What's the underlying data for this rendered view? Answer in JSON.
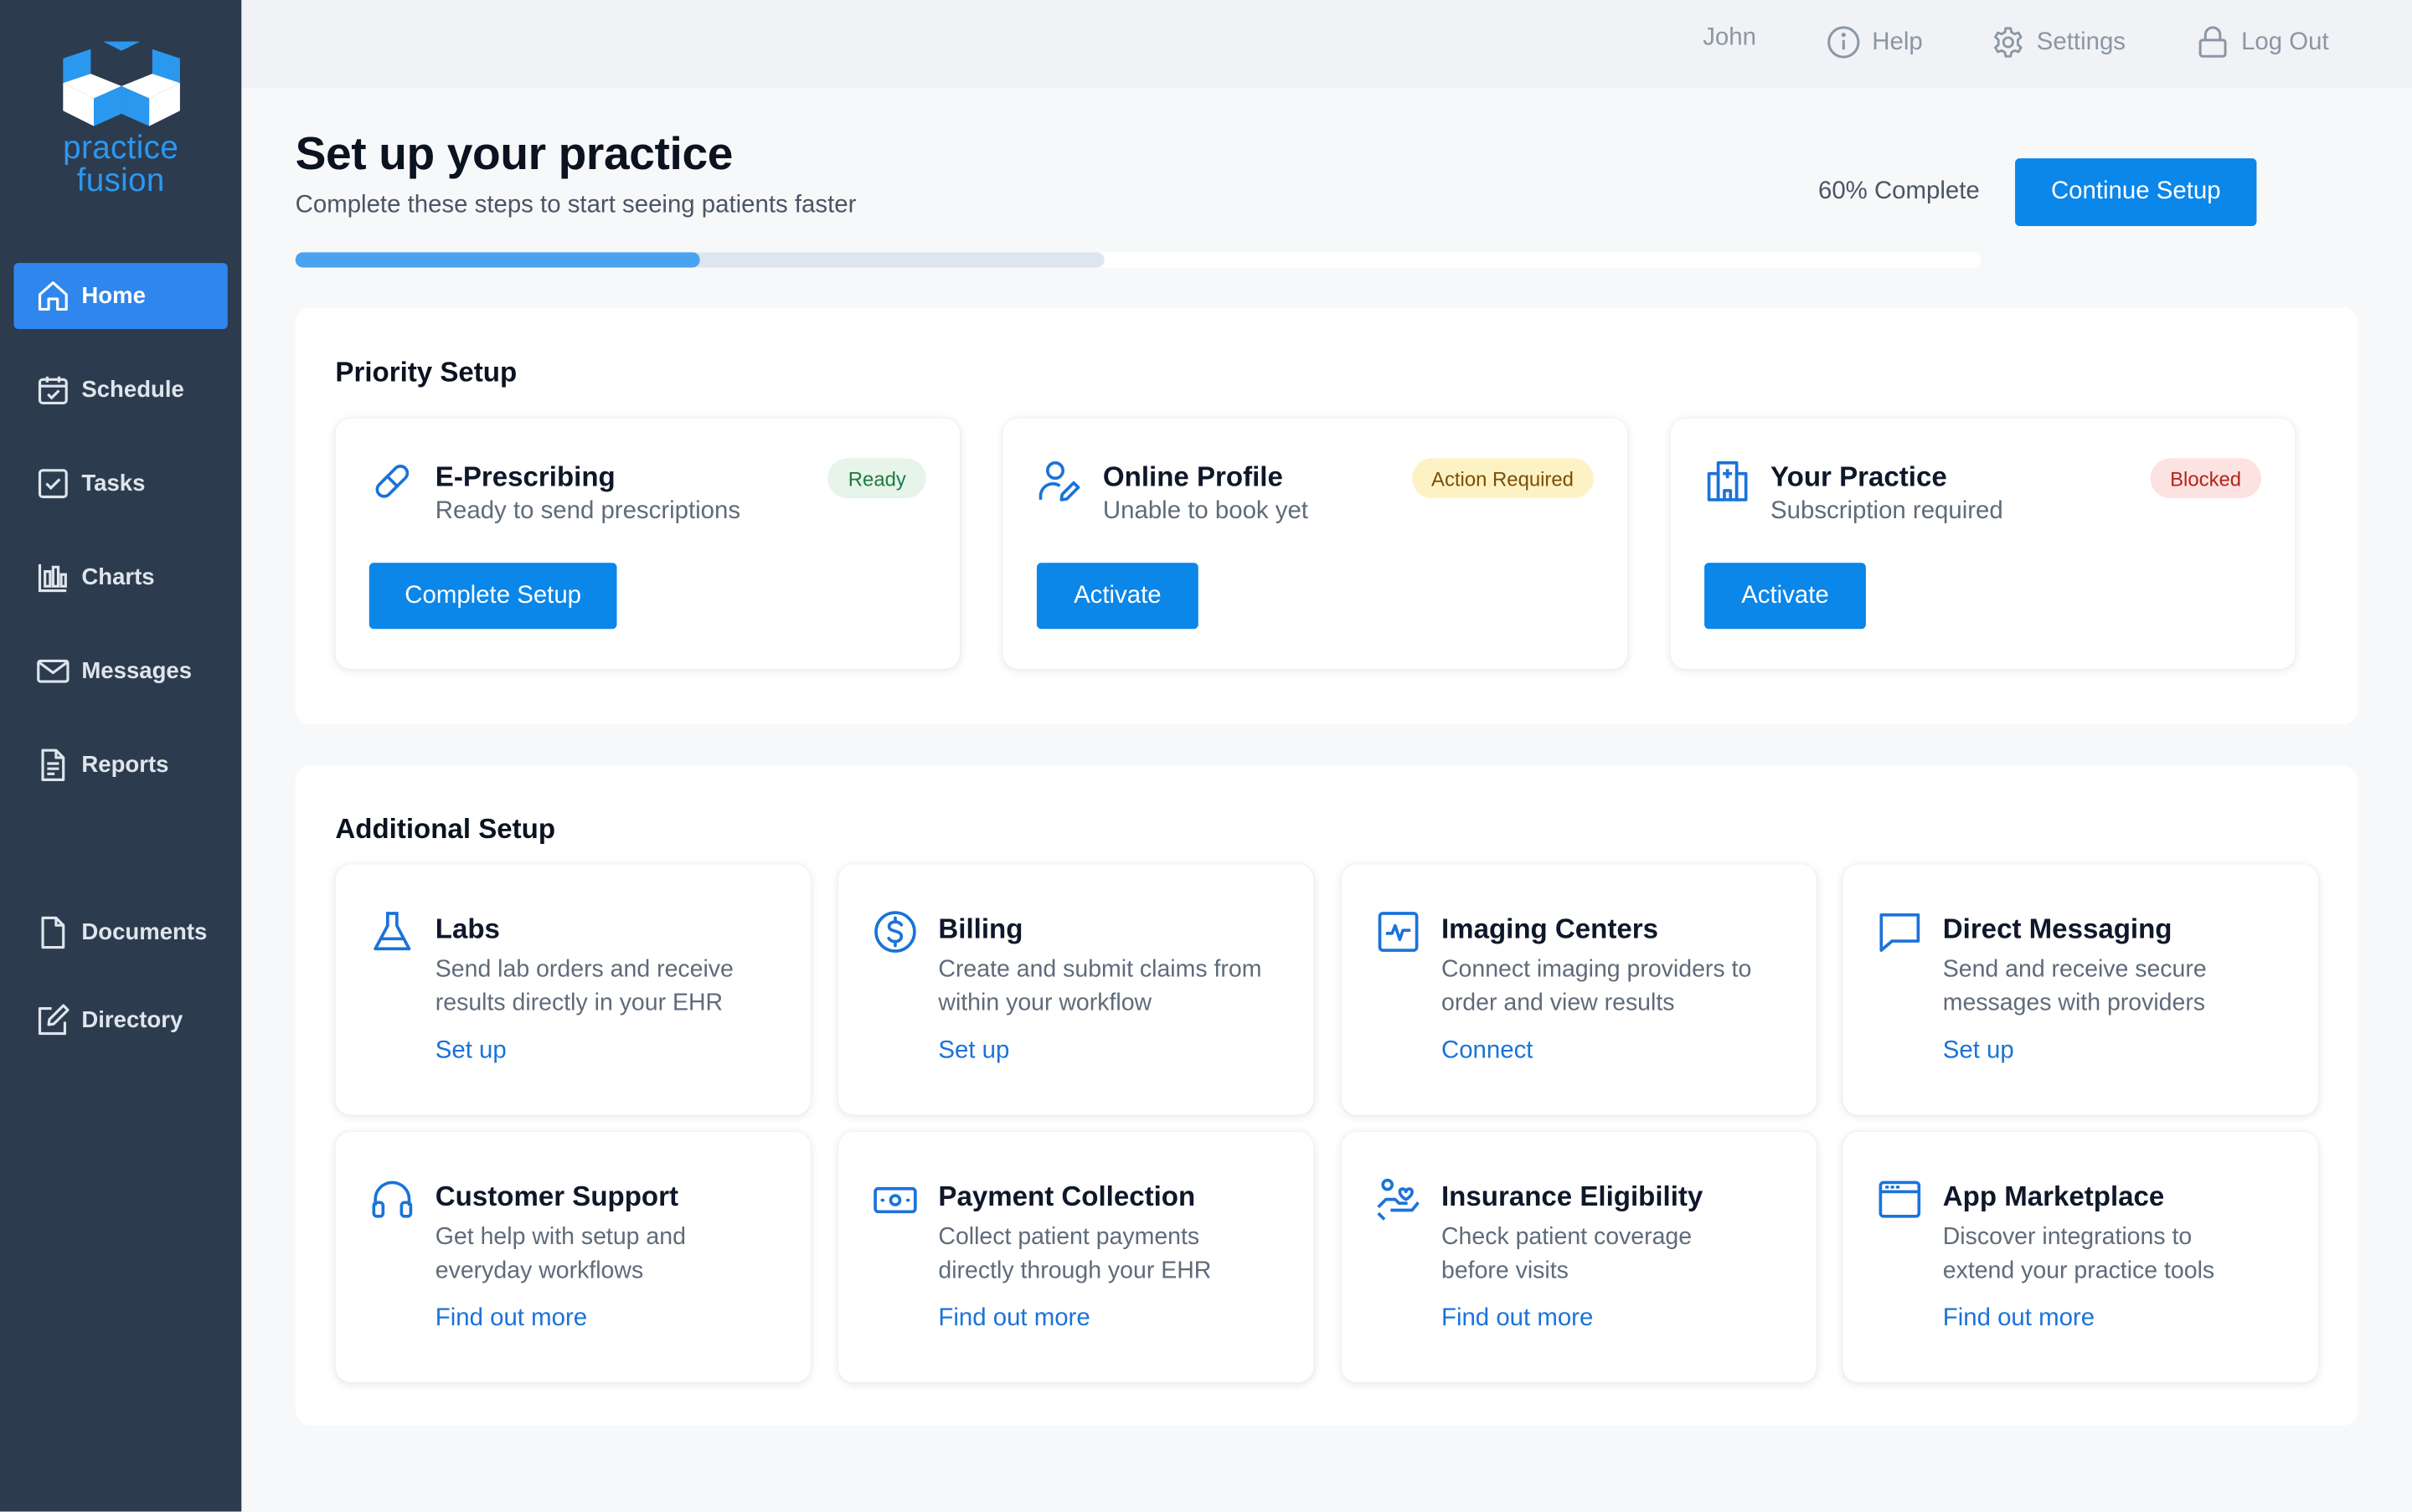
{
  "brand": {
    "line1": "practice",
    "line2": "fusion"
  },
  "sidebar": {
    "items": [
      {
        "label": "Home",
        "icon": "home-icon"
      },
      {
        "label": "Schedule",
        "icon": "calendar-icon"
      },
      {
        "label": "Tasks",
        "icon": "checkbox-icon"
      },
      {
        "label": "Charts",
        "icon": "bar-chart-icon"
      },
      {
        "label": "Messages",
        "icon": "envelope-icon"
      },
      {
        "label": "Reports",
        "icon": "report-icon"
      },
      {
        "label": "Documents",
        "icon": "document-icon"
      },
      {
        "label": "Directory",
        "icon": "edit-icon"
      }
    ]
  },
  "topbar": {
    "user": "John",
    "help": "Help",
    "settings": "Settings",
    "logout": "Log Out"
  },
  "header": {
    "title": "Set up your practice",
    "subtitle": "Complete these steps to start seeing patients faster",
    "progress_text": "60% Complete",
    "progress_value": 0.24,
    "progress_secondary": 0.48,
    "continue_label": "Continue Setup"
  },
  "priority": {
    "title": "Priority Setup",
    "cards": [
      {
        "title": "E-Prescribing",
        "subtitle": "Ready to send prescriptions",
        "badge": "Ready",
        "button": "Complete Setup",
        "icon": "pill-icon"
      },
      {
        "title": "Online Profile",
        "subtitle": "Unable to book yet",
        "badge": "Action Required",
        "button": "Activate",
        "icon": "user-edit-icon"
      },
      {
        "title": "Your Practice",
        "subtitle": "Subscription required",
        "badge": "Blocked",
        "button": "Activate",
        "icon": "hospital-icon"
      }
    ]
  },
  "additional": {
    "title": "Additional Setup",
    "cards": [
      {
        "title": "Labs",
        "line1": "Send lab orders and receive",
        "line2": "results directly in your EHR",
        "link": "Set up",
        "icon": "flask-icon"
      },
      {
        "title": "Billing",
        "line1": "Create and submit claims from",
        "line2": "within your workflow",
        "link": "Set up",
        "icon": "dollar-icon"
      },
      {
        "title": "Imaging Centers",
        "line1": "Connect imaging providers to",
        "line2": "order and view results",
        "link": "Connect",
        "icon": "pulse-icon"
      },
      {
        "title": "Direct Messaging",
        "line1": "Send and receive secure",
        "line2": "messages with providers",
        "link": "Set up",
        "icon": "chat-icon"
      },
      {
        "title": "Customer Support",
        "line1": "Get help with setup and",
        "line2": "everyday workflows",
        "link": "Find out more",
        "icon": "headset-icon"
      },
      {
        "title": "Payment Collection",
        "line1": "Collect patient payments",
        "line2": "directly through your EHR",
        "link": "Find out more",
        "icon": "cash-icon"
      },
      {
        "title": "Insurance Eligibility",
        "line1": "Check patient coverage",
        "line2": "before visits",
        "link": "Find out more",
        "icon": "hand-heart-icon"
      },
      {
        "title": "App Marketplace",
        "line1": "Discover integrations to",
        "line2": "extend your practice tools",
        "link": "Find out more",
        "icon": "browser-icon"
      }
    ]
  },
  "colors": {
    "sidebar": "#2d3b4f",
    "accent": "#0b86e9",
    "link": "#1a73d9"
  }
}
